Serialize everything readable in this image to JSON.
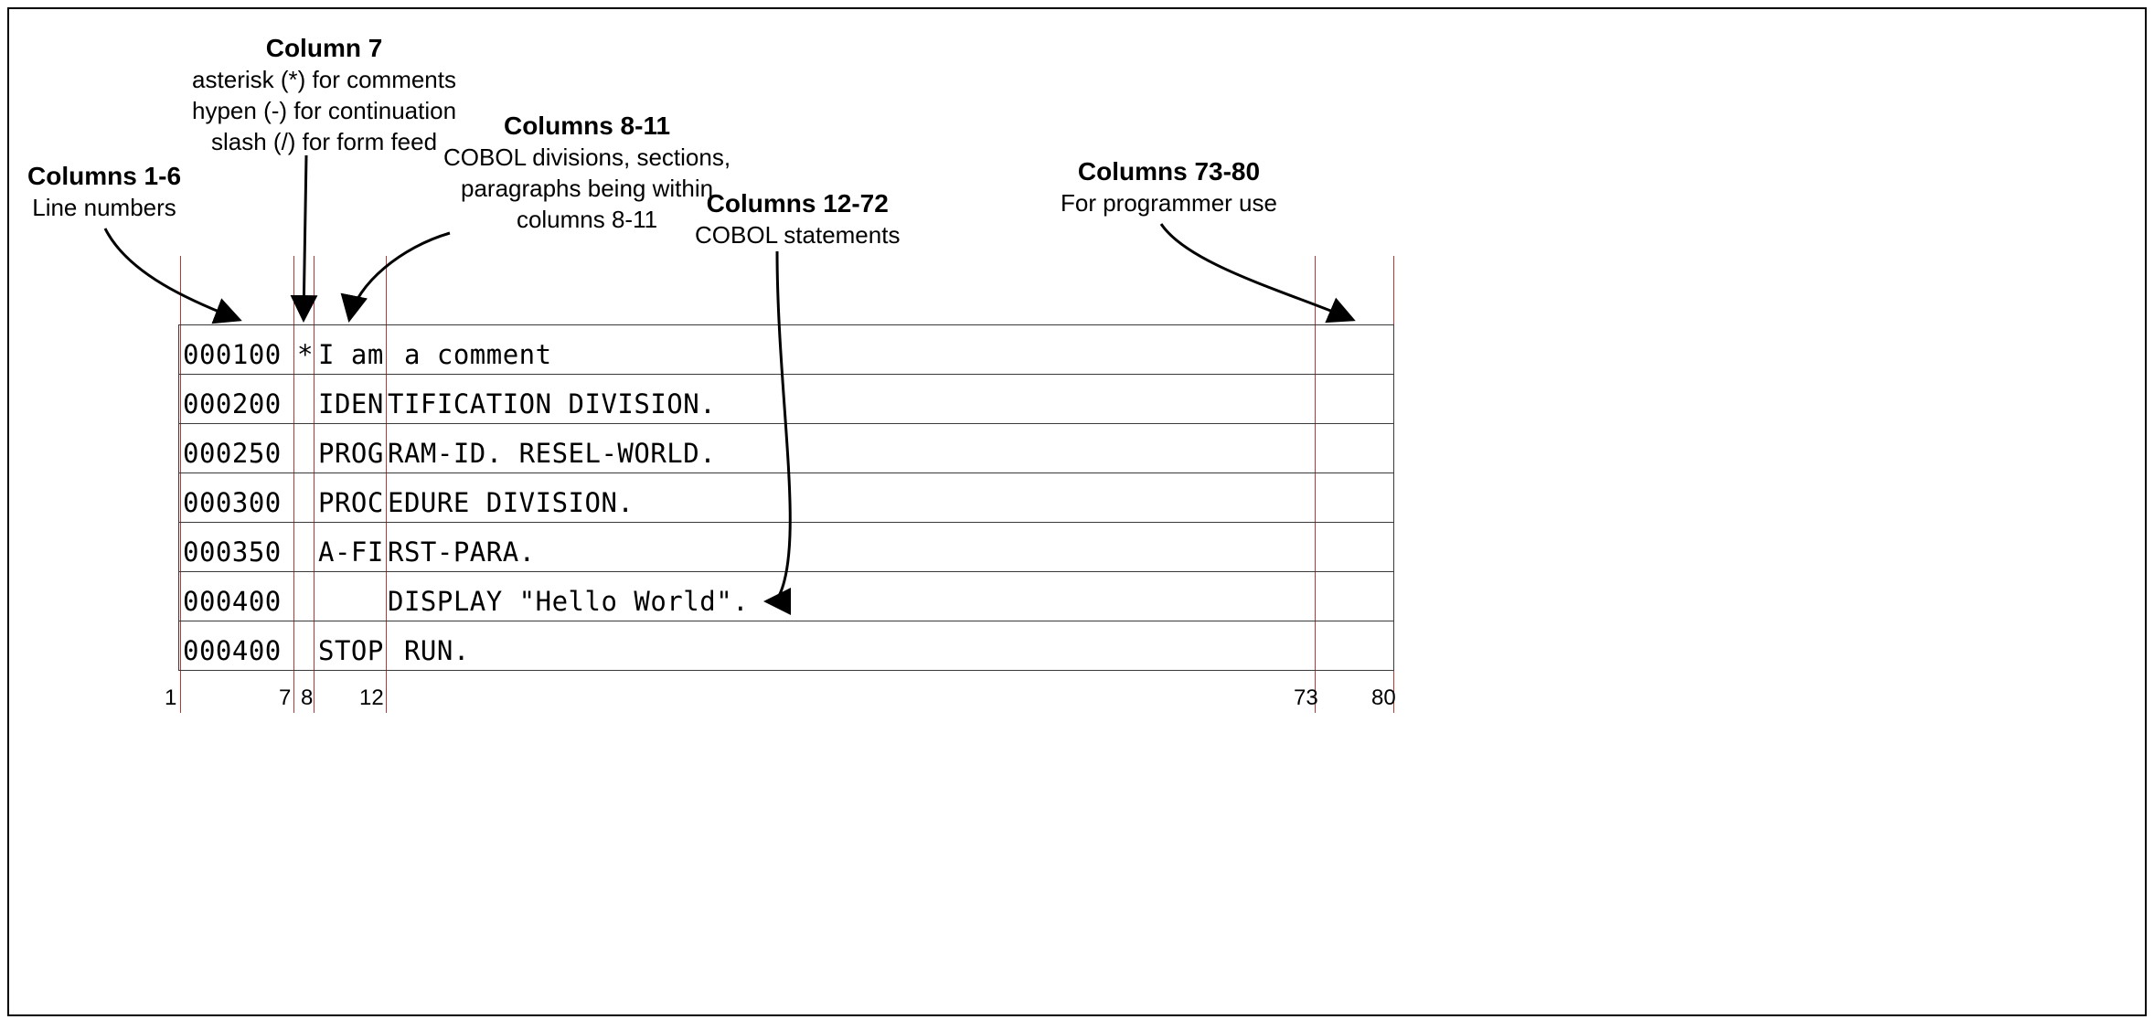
{
  "labels": {
    "col16": {
      "title": "Columns 1-6",
      "sub": "Line numbers"
    },
    "col7": {
      "title": "Column 7",
      "sub1": "asterisk (*) for comments",
      "sub2": "hypen (-) for continuation",
      "sub3": "slash (/) for form feed"
    },
    "col811": {
      "title": "Columns 8-11",
      "sub1": "COBOL divisions, sections,",
      "sub2": "paragraphs being within",
      "sub3": "columns 8-11"
    },
    "col1272": {
      "title": "Columns 12-72",
      "sub": "COBOL statements"
    },
    "col7380": {
      "title": "Columns 73-80",
      "sub": "For programmer use"
    }
  },
  "ticks": {
    "t1": "1",
    "t7": "7",
    "t8": "8",
    "t12": "12",
    "t73": "73",
    "t80": "80"
  },
  "rows": [
    {
      "ln": "000100",
      "ind": "*",
      "a": "I am",
      "b": " a comment"
    },
    {
      "ln": "000200",
      "ind": "",
      "a": "IDEN",
      "b": "TIFICATION DIVISION."
    },
    {
      "ln": "000250",
      "ind": "",
      "a": "PROG",
      "b": "RAM-ID. RESEL-WORLD."
    },
    {
      "ln": "000300",
      "ind": "",
      "a": "PROC",
      "b": "EDURE DIVISION."
    },
    {
      "ln": "000350",
      "ind": "",
      "a": "A-FI",
      "b": "RST-PARA."
    },
    {
      "ln": "000400",
      "ind": "",
      "a": "",
      "b": "DISPLAY \"Hello World\"."
    },
    {
      "ln": "000400",
      "ind": "",
      "a": "STOP",
      "b": " RUN."
    }
  ]
}
